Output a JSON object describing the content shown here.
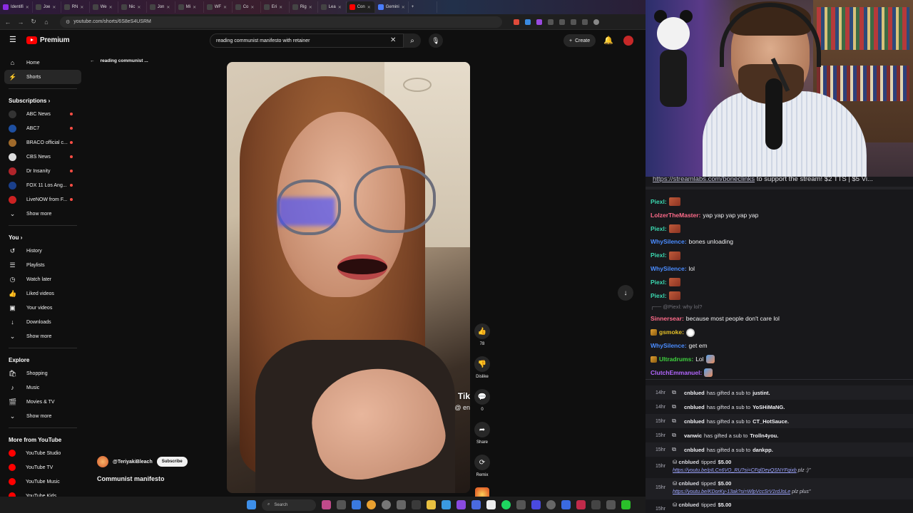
{
  "browser": {
    "tabs": [
      {
        "label": "Identifi",
        "color": "#8a2be2"
      },
      {
        "label": "Joe",
        "color": "#444"
      },
      {
        "label": "RN",
        "color": "#444"
      },
      {
        "label": "We",
        "color": "#444"
      },
      {
        "label": "Nic",
        "color": "#444"
      },
      {
        "label": "Jon",
        "color": "#444"
      },
      {
        "label": "Mi",
        "color": "#444"
      },
      {
        "label": "WF",
        "color": "#444"
      },
      {
        "label": "Co",
        "color": "#444"
      },
      {
        "label": "Eri",
        "color": "#444"
      },
      {
        "label": "Rig",
        "color": "#444"
      },
      {
        "label": "Lea",
        "color": "#444"
      },
      {
        "label": "Con",
        "color": "#ff0000"
      },
      {
        "label": "Gemini",
        "color": "#4a7dff"
      }
    ],
    "url": "youtube.com/shorts/6S8eS4USRM"
  },
  "header": {
    "logo_text": "Premium",
    "search_value": "reading communist manifesto with retainer",
    "create_label": "Create"
  },
  "sidebar": {
    "main": [
      {
        "label": "Home",
        "icon": "home-icon",
        "glyph": "⌂"
      },
      {
        "label": "Shorts",
        "icon": "shorts-icon",
        "glyph": "⚡"
      }
    ],
    "subscriptions_heading": "Subscriptions",
    "subscriptions": [
      {
        "label": "ABC News",
        "color": "#333"
      },
      {
        "label": "ABC7",
        "color": "#1e4fa0"
      },
      {
        "label": "BRACO official c...",
        "color": "#a06a2a"
      },
      {
        "label": "CBS News",
        "color": "#ddd"
      },
      {
        "label": "Dr Insanity",
        "color": "#b0242a"
      },
      {
        "label": "FOX 11 Los Ang...",
        "color": "#1a3f8a"
      },
      {
        "label": "LiveNOW from F...",
        "color": "#c22"
      }
    ],
    "show_more": "Show more",
    "you_heading": "You",
    "you_items": [
      {
        "label": "History",
        "icon": "history-icon",
        "glyph": "↺"
      },
      {
        "label": "Playlists",
        "icon": "playlists-icon",
        "glyph": "☰"
      },
      {
        "label": "Watch later",
        "icon": "watch-later-icon",
        "glyph": "◷"
      },
      {
        "label": "Liked videos",
        "icon": "liked-videos-icon",
        "glyph": "👍"
      },
      {
        "label": "Your videos",
        "icon": "your-videos-icon",
        "glyph": "▣"
      },
      {
        "label": "Downloads",
        "icon": "downloads-icon",
        "glyph": "↓"
      },
      {
        "label": "Show more",
        "icon": "chevron-down-icon",
        "glyph": "⌄"
      }
    ],
    "explore_heading": "Explore",
    "explore_items": [
      {
        "label": "Shopping",
        "icon": "shopping-icon",
        "glyph": "🛍"
      },
      {
        "label": "Music",
        "icon": "music-icon",
        "glyph": "♪"
      },
      {
        "label": "Movies & TV",
        "icon": "movies-icon",
        "glyph": "🎬"
      },
      {
        "label": "Show more",
        "icon": "chevron-down-icon",
        "glyph": "⌄"
      }
    ],
    "more_heading": "More from YouTube",
    "more_items": [
      {
        "label": "YouTube Studio"
      },
      {
        "label": "YouTube TV"
      },
      {
        "label": "YouTube Music"
      },
      {
        "label": "YouTube Kids"
      }
    ]
  },
  "shorts": {
    "back_title": "reading communist ...",
    "likes": "78",
    "dislike_label": "Dislike",
    "comments": "0",
    "share_label": "Share",
    "remix_label": "Remix",
    "watermark": "Tik",
    "watermark_handle": "@ en",
    "channel": "@TeriyakiBleach",
    "subscribe_label": "Subscribe",
    "title": "Communist manifesto"
  },
  "taskbar": {
    "search_placeholder": "Search"
  },
  "chat": {
    "ticker_link": "https://streamlabs.com/boneclinks",
    "ticker_text": " to support the stream! $2 TTS | $5 Vi...",
    "messages": [
      {
        "user": "Piexl:",
        "color": "#3bd8b0",
        "text": "",
        "emote": "emote"
      },
      {
        "user": "LolzerTheMaster:",
        "color": "#ff6b8a",
        "text": "yap yap yap yap yap",
        "emote": ""
      },
      {
        "user": "Piexl:",
        "color": "#3bd8b0",
        "text": "",
        "emote": "emote"
      },
      {
        "user": "WhySilence:",
        "color": "#4a8cff",
        "text": "bones unloading",
        "emote": ""
      },
      {
        "user": "Piexl:",
        "color": "#3bd8b0",
        "text": "",
        "emote": "emote"
      },
      {
        "user": "WhySilence:",
        "color": "#4a8cff",
        "text": "lol",
        "emote": ""
      },
      {
        "user": "Piexl:",
        "color": "#3bd8b0",
        "text": "",
        "emote": "emote"
      },
      {
        "user": "Piexl:",
        "color": "#3bd8b0",
        "text": "",
        "emote": "emote"
      }
    ],
    "reply_context": "@Piexl: why lol?",
    "messages2": [
      {
        "user": "Sinnersear:",
        "color": "#ff6b8a",
        "text": "because most people don't care lol",
        "emote": "",
        "badge": false
      },
      {
        "user": "gsmoke:",
        "color": "#e5c028",
        "text": "",
        "emote": "sk",
        "badge": true
      },
      {
        "user": "WhySilence:",
        "color": "#4a8cff",
        "text": "get em",
        "emote": "",
        "badge": false
      },
      {
        "user": "Ultradrums:",
        "color": "#3ed23e",
        "text": "Lol",
        "emote": "sm",
        "badge": true
      },
      {
        "user": "ClutchEmmanuel:",
        "color": "#b366ff",
        "text": "",
        "emote": "sm",
        "badge": false
      }
    ],
    "gift_events": [
      {
        "time": "14hr",
        "user": "cnblued",
        "mid": "has gifted a sub to",
        "target": "justint."
      },
      {
        "time": "14hr",
        "user": "cnblued",
        "mid": "has gifted a sub to",
        "target": "YoSHiMaNG."
      },
      {
        "time": "15hr",
        "user": "cnblued",
        "mid": "has gifted a sub to",
        "target": "CT_HotSauce."
      },
      {
        "time": "15hr",
        "user": "vanwic",
        "mid": "has gifted a sub to",
        "target": "Trolln4you."
      },
      {
        "time": "15hr",
        "user": "cnblued",
        "mid": "has gifted a sub to",
        "target": "dankpp."
      }
    ],
    "tip_events": [
      {
        "time": "15hr",
        "user": "cnblued",
        "mid": "tipped",
        "amount": "$5.00",
        "link": "https://youtu.be/pILCn6VO_RU?si=CFqlDeyQSNYFqixb",
        "note": " plz :)\""
      },
      {
        "time": "15hr",
        "user": "cnblued",
        "mid": "tipped",
        "amount": "$5.00",
        "link": "https://youtu.be/KDorKy-13ak?si=WlpVccSrV1rdJoLe",
        "note": " plz plus\""
      },
      {
        "time": "15hr",
        "user": "cnblued",
        "mid": "tipped",
        "amount": "$5.00",
        "link": "",
        "note": ""
      }
    ]
  }
}
